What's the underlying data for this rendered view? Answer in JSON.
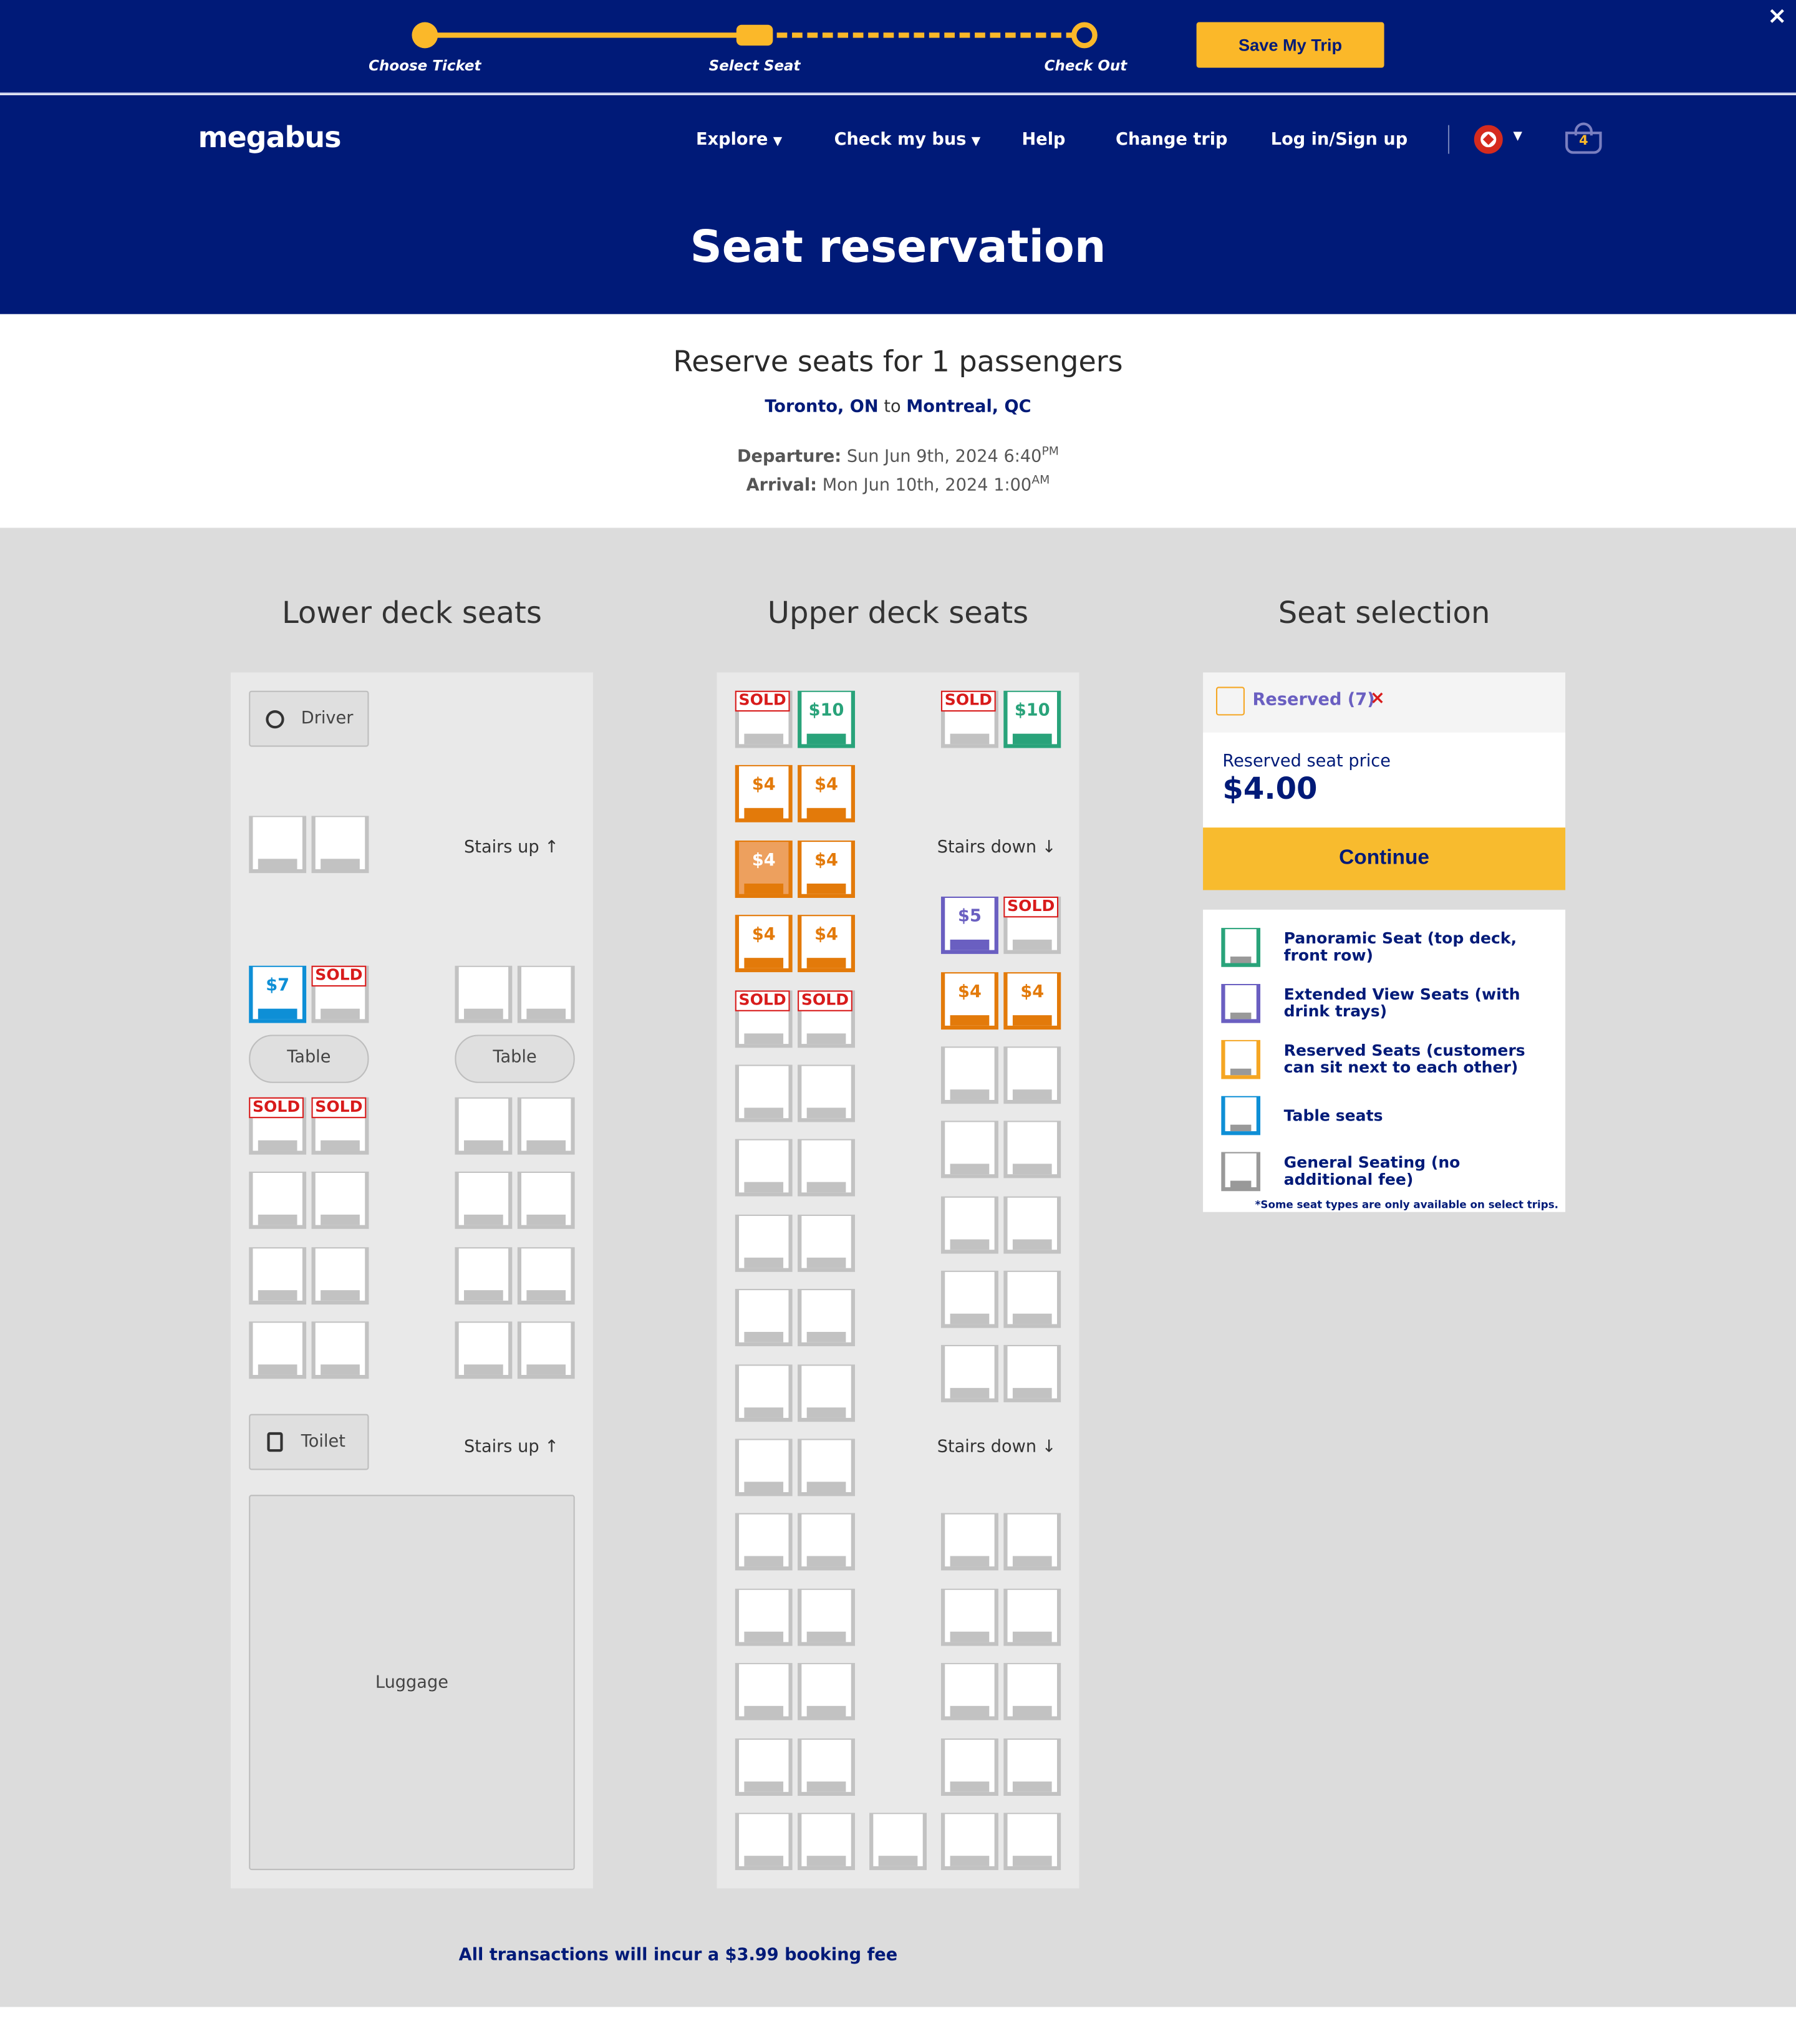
{
  "progress": {
    "steps": [
      "Choose Ticket",
      "Select Seat",
      "Check Out"
    ],
    "save_label": "Save My Trip",
    "close": "×"
  },
  "header": {
    "logo": "megabus",
    "nav": {
      "explore": "Explore",
      "check_my_bus": "Check my bus",
      "help": "Help",
      "change_trip": "Change trip",
      "login": "Log in/Sign up"
    },
    "country_flag_icon": "canada-flag-icon",
    "basket_count": "4",
    "title": "Seat reservation"
  },
  "trip": {
    "heading": "Reserve seats for 1 passengers",
    "origin": "Toronto, ON",
    "to": "to",
    "destination": "Montreal, QC",
    "departure_label": "Departure:",
    "departure": "Sun Jun 9th, 2024 6:40",
    "departure_ampm": "PM",
    "arrival_label": "Arrival:",
    "arrival": "Mon Jun 10th, 2024 1:00",
    "arrival_ampm": "AM"
  },
  "lower_deck": {
    "title": "Lower deck seats",
    "driver": "Driver",
    "stairs_up": "Stairs up",
    "table": "Table",
    "toilet": "Toilet",
    "luggage": "Luggage",
    "table_seat_price": "$7",
    "sold": "SOLD"
  },
  "upper_deck": {
    "title": "Upper deck seats",
    "stairs_down": "Stairs down",
    "sold": "SOLD",
    "panoramic_price": "$10",
    "reserved_price": "$4",
    "extended_price": "$5"
  },
  "selection": {
    "title": "Seat selection",
    "reserved_label": "Reserved (7)",
    "remove": "×",
    "price_label": "Reserved seat price",
    "price": "$4.00",
    "continue": "Continue"
  },
  "legend": {
    "items": [
      {
        "color": "#29a37a",
        "label": "Panoramic Seat (top deck, front row)"
      },
      {
        "color": "#6a5fc1",
        "label": "Extended View Seats (with drink trays)"
      },
      {
        "color": "#f5a623",
        "label": "Reserved Seats (customers can sit next to each other)"
      },
      {
        "color": "#0e8fd6",
        "label": "Table seats"
      },
      {
        "color": "#999999",
        "label": "General Seating (no additional fee)"
      }
    ],
    "note": "*Some seat types are only available on select trips."
  },
  "footer": {
    "fee_note": "All transactions will incur a $3.99 booking fee"
  }
}
